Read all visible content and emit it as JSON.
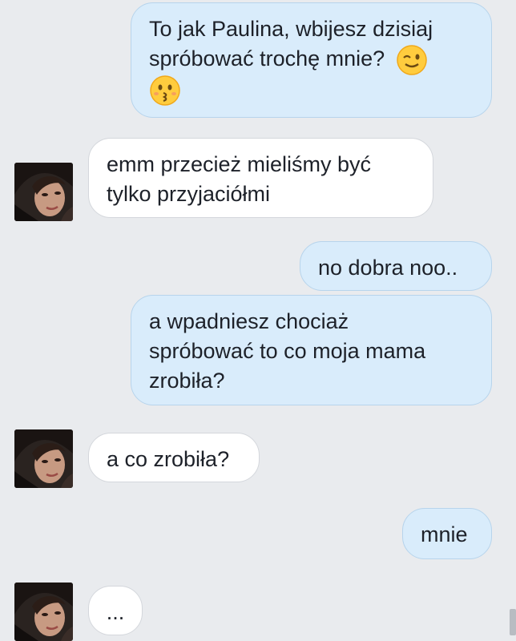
{
  "conversation": {
    "messages": [
      {
        "direction": "outgoing",
        "lines": [
          "To jak Paulina, wbijesz dzisiaj",
          "spróbować trochę mnie?"
        ],
        "emoji": [
          "wink-emoji",
          "kissing-emoji"
        ]
      },
      {
        "direction": "incoming",
        "lines": [
          "emm przecież mieliśmy być",
          "tylko przyjaciółmi"
        ]
      },
      {
        "direction": "outgoing",
        "lines": [
          "no dobra noo.."
        ]
      },
      {
        "direction": "outgoing",
        "lines": [
          "a wpadniesz chociaż",
          "spróbować to co moja mama",
          "zrobiła?"
        ]
      },
      {
        "direction": "incoming",
        "lines": [
          "a co zrobiła?"
        ]
      },
      {
        "direction": "outgoing",
        "lines": [
          "mnie"
        ]
      },
      {
        "direction": "incoming",
        "lines": [
          "..."
        ]
      }
    ]
  },
  "colors": {
    "background": "#e9ebee",
    "outgoing_bubble": "#d9ecfb",
    "incoming_bubble": "#ffffff",
    "text": "#1d2129"
  }
}
